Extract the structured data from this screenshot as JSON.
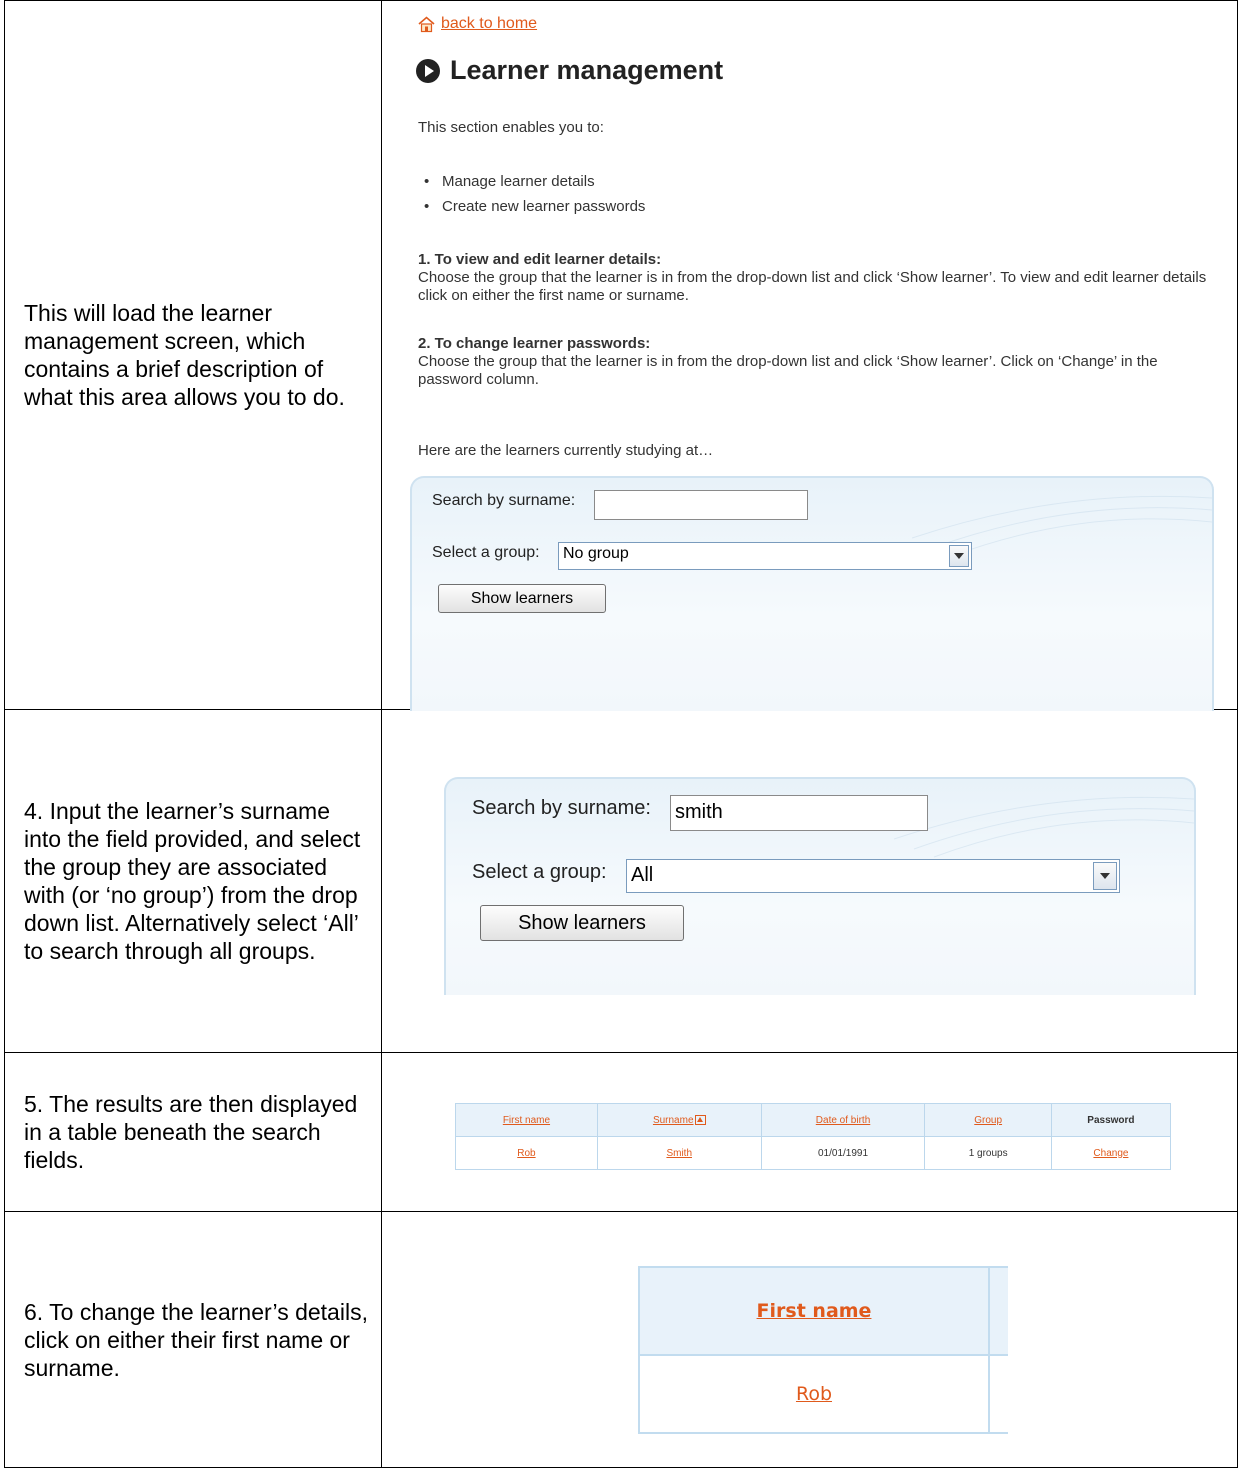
{
  "rows": {
    "r1": {
      "instruction": "This will load the learner management screen, which contains a brief description of what this area allows you to do."
    },
    "r4": {
      "instruction": "4. Input the learner’s surname into the field provided, and select the group they are associated with (or ‘no group’) from the drop down list. Alternatively select ‘All’ to search through all groups."
    },
    "r5": {
      "instruction": "5.  The results are then displayed in a table beneath the search fields."
    },
    "r6": {
      "instruction": "6.  To change the learner’s details, click on either their first name or surname."
    }
  },
  "screen1": {
    "back_link": "back to home",
    "title": "Learner management",
    "intro": "This section enables you to:",
    "bullets": [
      "Manage learner details",
      "Create new learner passwords"
    ],
    "step1_head": "1. To view and edit learner details:",
    "step1_text": "Choose the group that the learner is in from the drop-down list and click ‘Show learner’. To view and edit learner details click on either the first name or surname.",
    "step2_head": "2. To change learner passwords:",
    "step2_text": "Choose the group that the learner is in from the drop-down list and click ‘Show learner’. Click on ‘Change’ in the password column.",
    "here": "Here are the learners currently studying at…",
    "search_label": "Search by surname:",
    "search_value": "",
    "group_label": "Select a group:",
    "group_value": "No group",
    "show_button": "Show learners"
  },
  "screen4": {
    "search_label": "Search by surname:",
    "search_value": "smith",
    "group_label": "Select a group:",
    "group_value": "All",
    "show_button": "Show learners"
  },
  "results": {
    "headers": [
      "First name",
      "Surname",
      "Date of birth",
      "Group",
      "Password"
    ],
    "row": [
      "Rob",
      "Smith",
      "01/01/1991",
      "1 groups",
      "Change"
    ]
  },
  "zoom": {
    "header": "First name",
    "cell": "Rob"
  },
  "colors": {
    "link": "#e05a1c",
    "table_border": "#bcd7ec",
    "header_bg": "#e8f2fa"
  }
}
